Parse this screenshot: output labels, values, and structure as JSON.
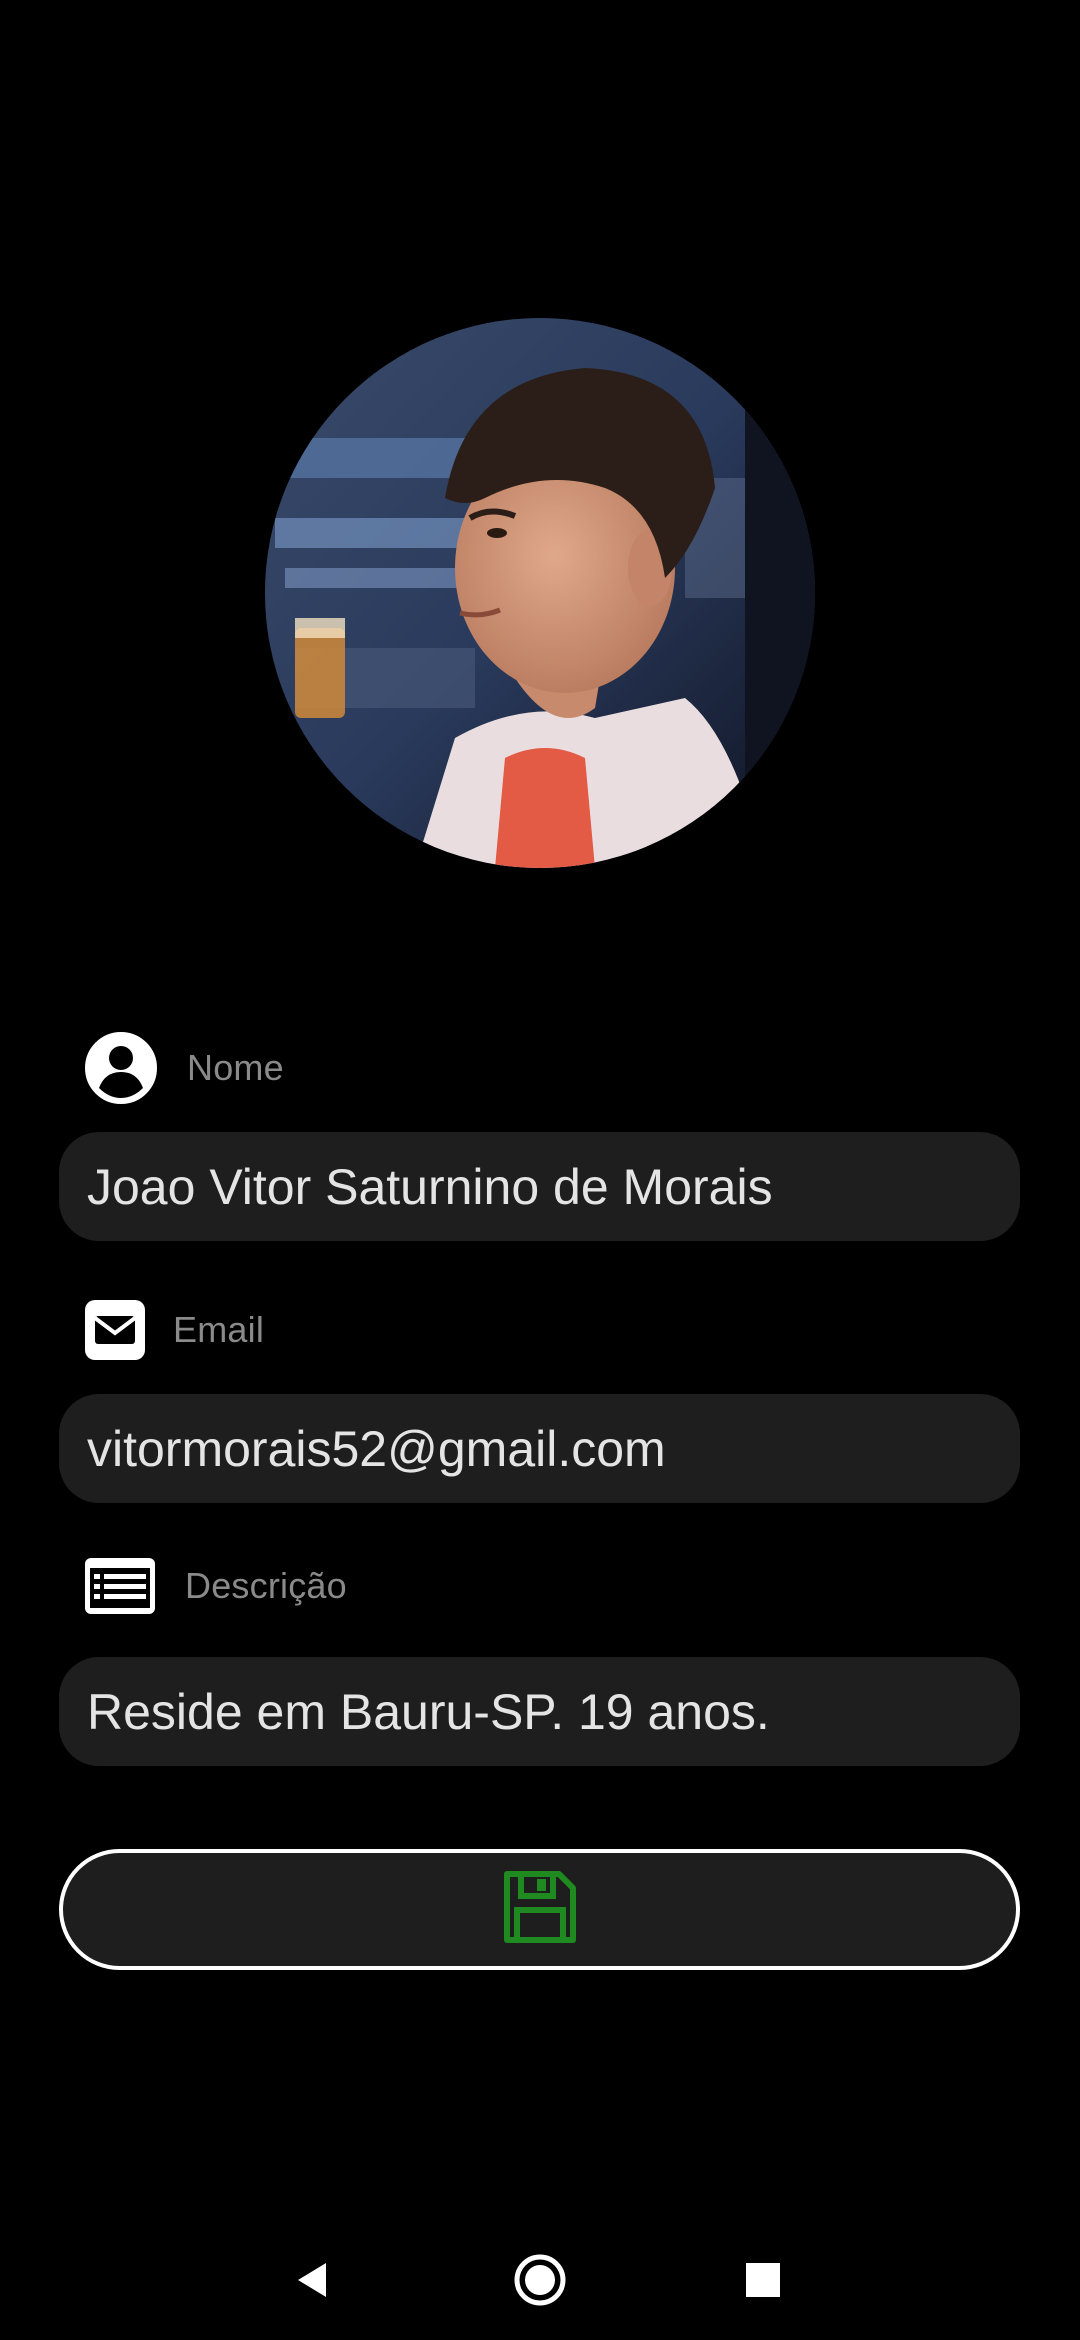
{
  "profile": {
    "avatar_icon": "profile-photo"
  },
  "fields": {
    "name": {
      "label": "Nome",
      "value": "Joao Vitor Saturnino de Morais",
      "icon": "account-circle-icon"
    },
    "email": {
      "label": "Email",
      "value": "vitormorais52@gmail.com",
      "icon": "envelope-icon"
    },
    "description": {
      "label": "Descrição",
      "value": "Reside em Bauru-SP. 19 anos.",
      "icon": "list-icon"
    }
  },
  "save_button": {
    "icon": "floppy-disk-icon",
    "icon_color": "#1f8a1f"
  },
  "navigation": {
    "back_icon": "triangle-back-icon",
    "home_icon": "circle-home-icon",
    "recents_icon": "square-recents-icon"
  },
  "colors": {
    "background": "#000000",
    "field_background": "#1e1e1e",
    "label_text": "#8a8a8a",
    "value_text": "#e4e4e4",
    "button_border": "#ffffff"
  }
}
